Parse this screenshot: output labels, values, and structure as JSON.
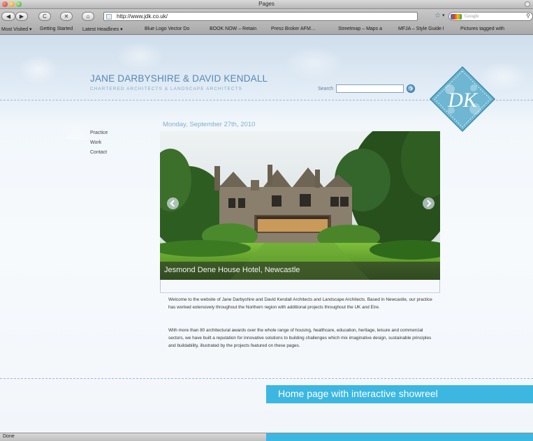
{
  "window": {
    "title": "Pages"
  },
  "toolbar": {
    "back_label": "◀▶",
    "reload_label": "C",
    "stop_label": "✕",
    "home_label": "⌂",
    "url": "http://www.jdk.co.uk/",
    "search_placeholder": "Google",
    "star": "☆",
    "dropdown": "▾",
    "search_icon": "⚲"
  },
  "bookmarks": [
    "Most Visited ▾",
    "Getting Started",
    "Latest Headlines ▾",
    "Blue Logo Vector Do",
    "BOOK NOW – Retain",
    "Press Broker AFM…",
    "Streetmap – Maps a",
    "MFJA – Style Guide I",
    "Pictures tagged with"
  ],
  "site": {
    "title": "JANE DARBYSHIRE & DAVID KENDALL",
    "subtitle": "CHARTERED ARCHITECTS & LANDSCAPE ARCHITECTS",
    "logo_letters": "DK",
    "search_label": "Search"
  },
  "nav": [
    "Practice",
    "Work",
    "Contact"
  ],
  "date": "Monday, September 27th, 2010",
  "slide": {
    "caption": "Jesmond Dene House Hotel, Newcastle"
  },
  "content": {
    "paragraph1": "Welcome to the website of Jane Darbyshire and David Kendall Architects and Landscape Architects. Based in Newcastle, our practice has worked extensively throughout the Northern region with additional projects throughout the UK and Eire.",
    "paragraph2": "With more than 80 architectural awards over the whole range of housing, healthcare, education, heritage, leisure and commercial sectors, we have built a reputation for innovative solutions to building challenges which mix imaginative design, sustainable principles and buildability, illustrated by the projects featured on these pages."
  },
  "callout": "Home page with interactive showreel",
  "status": "Done",
  "colors": {
    "accent": "#3cb7e2",
    "title_blue": "#5588b3",
    "date_blue": "#7fb0cf"
  }
}
